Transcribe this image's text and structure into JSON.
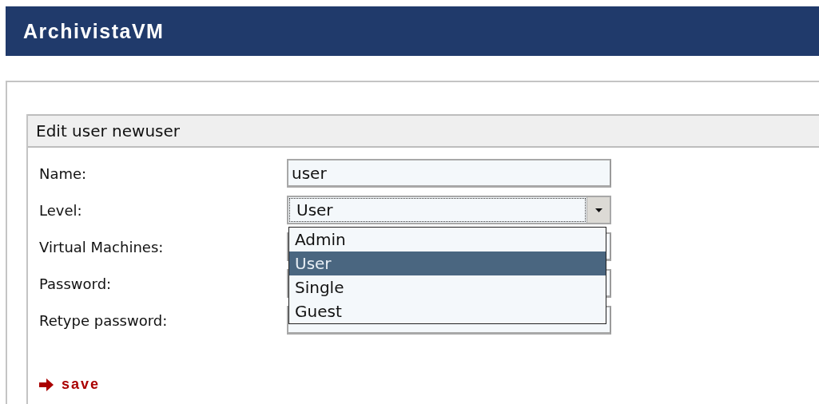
{
  "app_title": "ArchivistaVM",
  "panel": {
    "title": "Edit user newuser"
  },
  "fields": [
    {
      "label": "Name:",
      "kind": "text",
      "value": "user"
    },
    {
      "label": "Level:",
      "kind": "select",
      "value": "User",
      "expanded": true,
      "options": [
        {
          "label": "Admin",
          "selected": false
        },
        {
          "label": "User",
          "selected": true
        },
        {
          "label": "Single",
          "selected": false
        },
        {
          "label": "Guest",
          "selected": false
        }
      ]
    },
    {
      "label": "Virtual Machines:",
      "kind": "text"
    },
    {
      "label": "Password:",
      "kind": "password"
    },
    {
      "label": "Retype password:",
      "kind": "password"
    }
  ],
  "save_link": "save"
}
